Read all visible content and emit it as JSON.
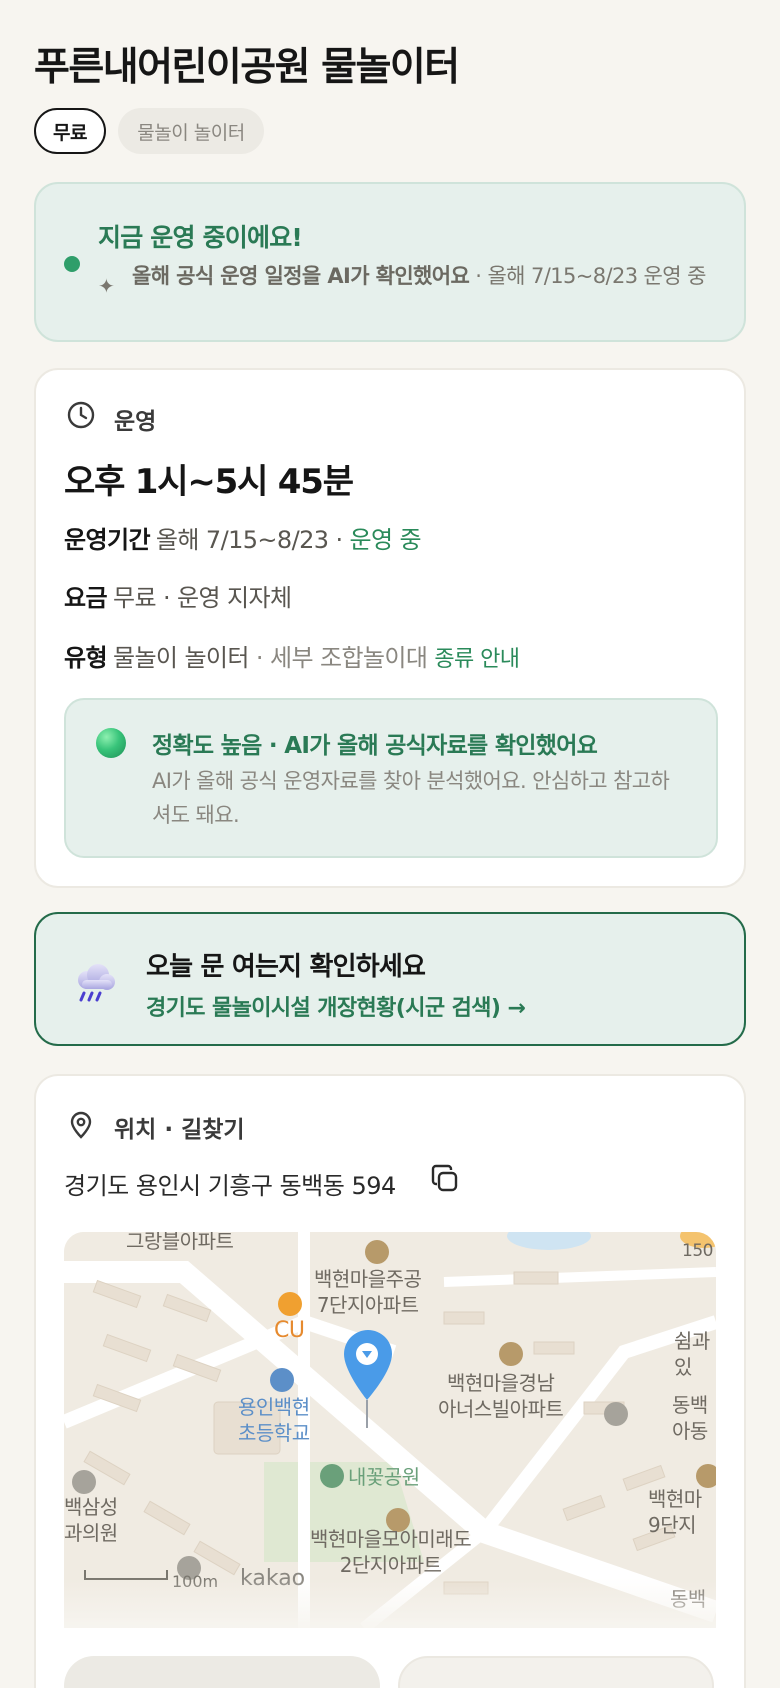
{
  "page": {
    "title": "푸른내어린이공원 물놀이터",
    "chips": [
      "무료",
      "물놀이 놀이터"
    ]
  },
  "status": {
    "headline": "지금 운영 중이에요!",
    "sparkle_icon": "sparkle-icon",
    "note_bold": "올해 공식 운영 일정을 AI가 확인했어요",
    "note_rest": " · 올해 7/15~8/23 운영 중"
  },
  "operation": {
    "section_title": "운영",
    "hours": "오후 1시~5시 45분",
    "period_label": "운영기간",
    "period_value": "올해 7/15~8/23 · ",
    "period_status": "운영 중",
    "fee_label": "요금",
    "fee_value": "무료 · 운영 지자체",
    "type_label": "유형",
    "type_value": "물놀이 놀이터",
    "type_detail": " · 세부 조합놀이대 ",
    "type_link": "종류 안내"
  },
  "accuracy": {
    "headline": "정확도 높음 · AI가 올해 공식자료를 확인했어요",
    "body": "AI가 올해 공식 운영자료를 찾아 분석했어요. 안심하고 참고하셔도 돼요."
  },
  "cta": {
    "headline": "오늘 문 여는지 확인하세요",
    "link": "경기도 물놀이시설 개장현황(시군 검색) →"
  },
  "location": {
    "section_title": "위치 · 길찾기",
    "address": "경기도 용인시 기흥구 동백동 594",
    "map": {
      "labels": {
        "apt_top": "그랑블아파트",
        "baekhyeon7": "백현마을주공\n7단지아파트",
        "cu": "CU",
        "school": "용인백현\n초등학교",
        "gyeongnam": "백현마을경남\n아너스빌아파트",
        "park": "내꽃공원",
        "moa": "백현마을모아미래도\n2단지아파트",
        "clinic": "백삼성\n과의원",
        "rest": "쉼과\n있",
        "dongbaek": "동백\n아동",
        "baekhyeon9": "백현마\n9단지",
        "dongbaek2": "동백",
        "scale_text": "100m",
        "top_right": "150"
      },
      "brand": "kakao",
      "colors": {
        "land": "#f0ebe2",
        "road": "#ffffff",
        "building": "#e8dfd2",
        "park": "#dfe8d2",
        "water": "#cfe4f2",
        "pin": "#4a9be8"
      }
    }
  },
  "colors": {
    "accent_green": "#2a7a55",
    "status_bg": "#e6f0ec",
    "cta_border": "#246b4a",
    "page_bg": "#f7f5f0"
  }
}
